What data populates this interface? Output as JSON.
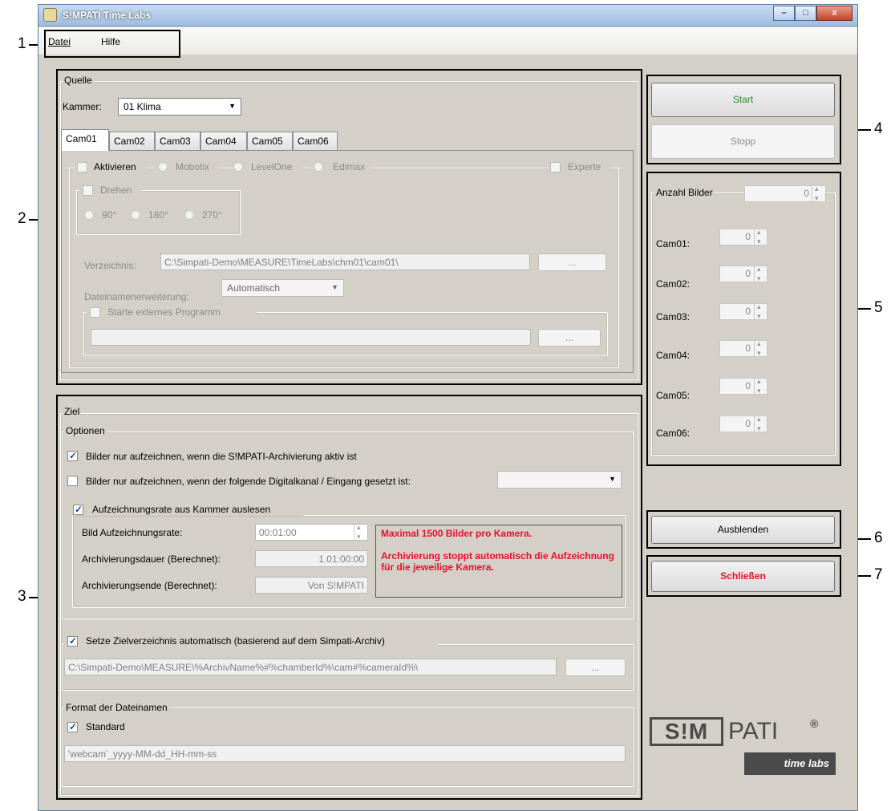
{
  "window": {
    "title": "S!MPATI Time Labs",
    "buttons": {
      "minimize": "–",
      "maximize": "□",
      "close": "x"
    }
  },
  "menu": {
    "items": [
      "Datei",
      "Hilfe"
    ]
  },
  "callouts": [
    "1",
    "2",
    "3",
    "4",
    "5",
    "6",
    "7"
  ],
  "quelle": {
    "title": "Quelle",
    "kammer_label": "Kammer:",
    "kammer_value": "01 Klima",
    "tabs": [
      "Cam01",
      "Cam02",
      "Cam03",
      "Cam04",
      "Cam05",
      "Cam06"
    ],
    "aktivieren": "Aktivieren",
    "mobotix": "Mobotix",
    "levelone": "LevelOne",
    "edimax": "Edimax",
    "experte": "Experte",
    "drehen": "Drehen",
    "deg90": "90°",
    "deg180": "180°",
    "deg270": "270°",
    "verzeichnis_label": "Verzeichnis:",
    "verzeichnis_value": "C:\\Simpati-Demo\\MEASURE\\TimeLabs\\chm01\\cam01\\",
    "browse": "...",
    "ext_label": "Dateinamenerweiterung:",
    "ext_value": "Automatisch",
    "starte_label": "Starte externes Programm",
    "starte_value": "",
    "browse2": "..."
  },
  "ziel": {
    "title": "Ziel",
    "optionen": "Optionen",
    "opt1": "Bilder nur aufzeichnen, wenn die S!MPATI-Archivierung aktiv ist",
    "opt2": "Bilder nur aufzeichnen, wenn der folgende Digitalkanal / Eingang gesetzt ist:",
    "digital_value": "",
    "aufz_label": "Aufzeichnungsrate aus Kammer auslesen",
    "rate_label": "Bild Aufzeichnungsrate:",
    "rate_value": "00:01:00",
    "dauer_label": "Archivierungsdauer (Berechnet):",
    "dauer_value": "1.01:00:00",
    "ende_label": "Archivierungsende (Berechnet):",
    "ende_value": "Von S!MPATI",
    "info1": "Maximal 1500 Bilder pro Kamera.",
    "info2": "Archivierung stoppt automatisch die Aufzeichnung für die jeweilige Kamera.",
    "setze_label": "Setze Zielverzeichnis automatisch (basierend auf dem Simpati-Archiv)",
    "setze_value": "C:\\Simpati-Demo\\MEASURE\\%ArchivName%#%chamberId%\\cam#%cameraId%\\",
    "browse": "...",
    "format_title": "Format der Dateinamen",
    "standard": "Standard",
    "format_value": "'webcam'_yyyy-MM-dd_HH-mm-ss"
  },
  "actions": {
    "start": "Start",
    "stopp": "Stopp",
    "ausblenden": "Ausblenden",
    "schliessen": "Schließen"
  },
  "anzahl": {
    "label": "Anzahl Bilder",
    "total": "0",
    "cams": [
      {
        "label": "Cam01:",
        "value": "0"
      },
      {
        "label": "Cam02:",
        "value": "0"
      },
      {
        "label": "Cam03:",
        "value": "0"
      },
      {
        "label": "Cam04:",
        "value": "0"
      },
      {
        "label": "Cam05:",
        "value": "0"
      },
      {
        "label": "Cam06:",
        "value": "0"
      }
    ]
  },
  "logo": {
    "left": "S!M",
    "right": "PATI",
    "reg": "®",
    "sub": "time labs"
  }
}
